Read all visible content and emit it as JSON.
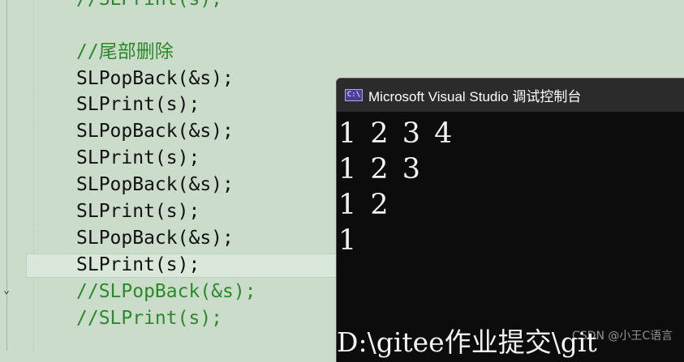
{
  "editor": {
    "lines": [
      {
        "text": "//SLPrint(s);",
        "comment": true
      },
      {
        "text": "",
        "comment": false
      },
      {
        "text": "//尾部删除",
        "comment": true
      },
      {
        "text": "SLPopBack(&s);",
        "comment": false
      },
      {
        "text": "SLPrint(s);",
        "comment": false
      },
      {
        "text": "SLPopBack(&s);",
        "comment": false
      },
      {
        "text": "SLPrint(s);",
        "comment": false
      },
      {
        "text": "SLPopBack(&s);",
        "comment": false
      },
      {
        "text": "SLPrint(s);",
        "comment": false
      },
      {
        "text": "SLPopBack(&s);",
        "comment": false
      },
      {
        "text": "SLPrint(s);",
        "comment": false
      },
      {
        "text": "//SLPopBack(&s);",
        "comment": true
      },
      {
        "text": "//SLPrint(s);",
        "comment": true
      }
    ],
    "fold_glyph": "⌄"
  },
  "console": {
    "icon_text": "C:\\",
    "title": "Microsoft Visual Studio 调试控制台",
    "output": [
      "1 2 3 4",
      "1 2 3",
      "1 2",
      "1"
    ],
    "prompt": "D:\\gitee作业提交\\git"
  },
  "watermark": "CSDN @小王C语言",
  "colors": {
    "editor_bg": "#cbdccb",
    "comment": "#2a8a2a",
    "console_bg": "#0c0c0c",
    "titlebar_bg": "#2b2b2b",
    "icon_bg": "#4c3f9a"
  }
}
